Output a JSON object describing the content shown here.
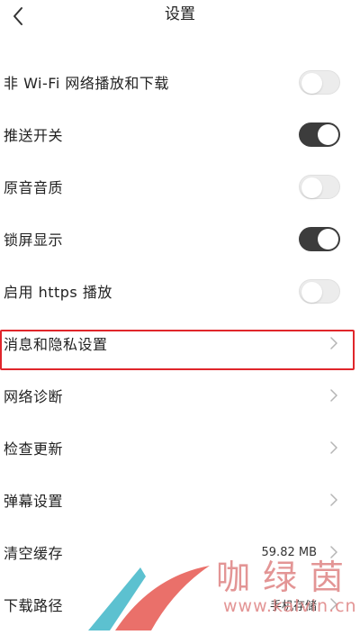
{
  "header": {
    "title": "设置",
    "back_icon": "chevron-left-icon"
  },
  "settings": [
    {
      "label": "非 Wi-Fi 网络播放和下载",
      "type": "toggle",
      "on": false
    },
    {
      "label": "推送开关",
      "type": "toggle",
      "on": true
    },
    {
      "label": "原音音质",
      "type": "toggle",
      "on": false
    },
    {
      "label": "锁屏显示",
      "type": "toggle",
      "on": true
    },
    {
      "label": "启用 https 播放",
      "type": "toggle",
      "on": false
    },
    {
      "label": "消息和隐私设置",
      "type": "link",
      "highlighted": true
    },
    {
      "label": "网络诊断",
      "type": "link"
    },
    {
      "label": "检查更新",
      "type": "link"
    },
    {
      "label": "弹幕设置",
      "type": "link"
    },
    {
      "label": "清空缓存",
      "type": "link",
      "value": "59.82 MB"
    },
    {
      "label": "下载路径",
      "type": "link",
      "value": "手机存储"
    }
  ],
  "watermark": {
    "text": "咖绿茵",
    "url": "www.kalvin.cn"
  },
  "colors": {
    "toggle_on": "#3c3c3c",
    "toggle_off": "#ececec",
    "highlight": "#e0262b",
    "watermark": "#e08a8a"
  }
}
